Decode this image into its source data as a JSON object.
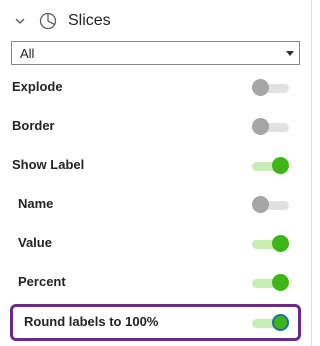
{
  "section": {
    "title": "Slices",
    "icon": "pie-chart-icon",
    "expanded": true
  },
  "dropdown": {
    "value": "All"
  },
  "rows": [
    {
      "label": "Explode",
      "on": false
    },
    {
      "label": "Border",
      "on": false
    },
    {
      "label": "Show Label",
      "on": true
    },
    {
      "label": "Name",
      "on": false
    },
    {
      "label": "Value",
      "on": true
    },
    {
      "label": "Percent",
      "on": true
    },
    {
      "label": "Round labels to 100%",
      "on": true,
      "highlighted": true
    }
  ],
  "colors": {
    "toggle_on_knob": "#3fb618",
    "toggle_on_track": "#c7ecb4",
    "toggle_off_knob": "#a6a6a6",
    "toggle_off_track": "#e1e1e1",
    "highlight_border": "#6a2a8a"
  }
}
